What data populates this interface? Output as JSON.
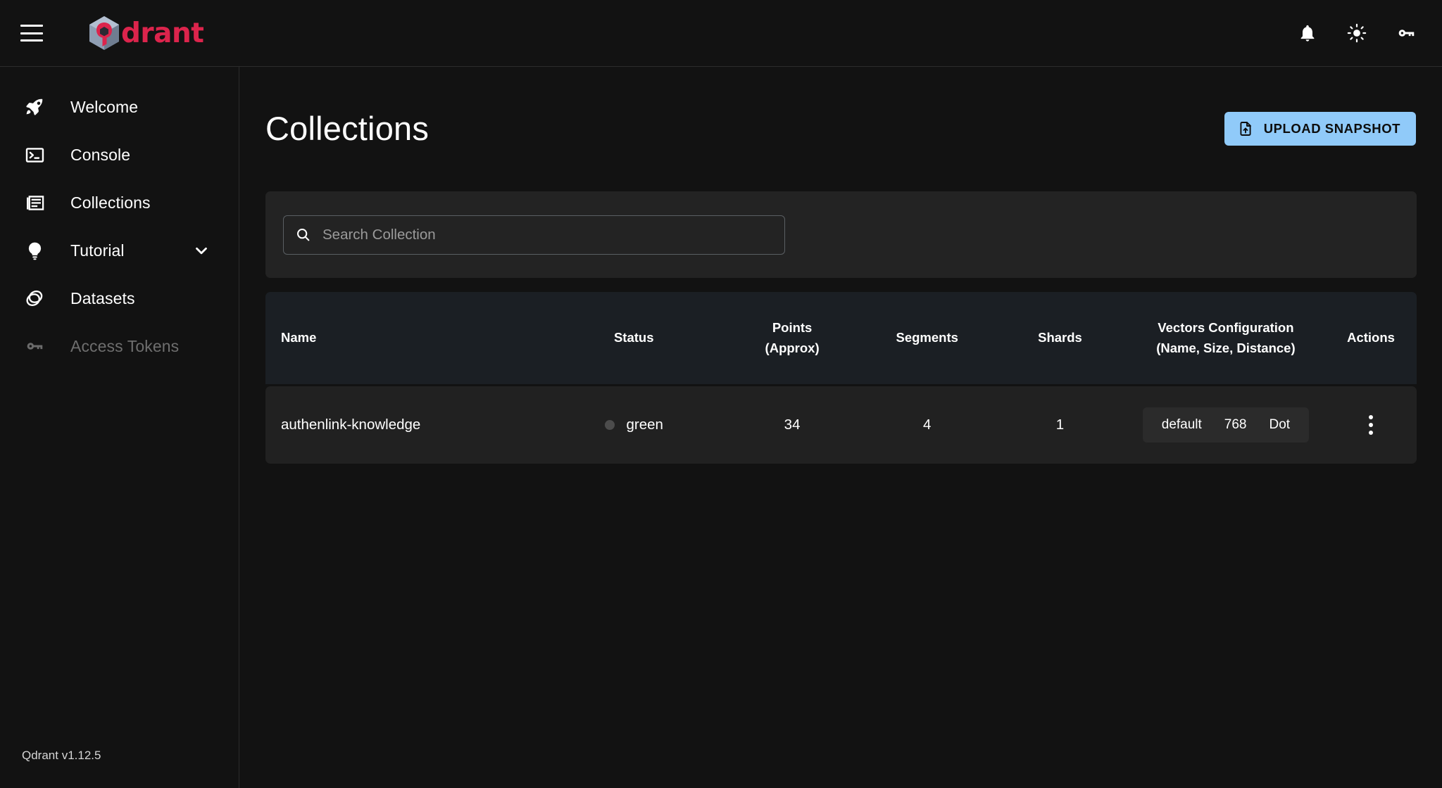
{
  "topbar": {
    "menu_icon": "hamburger-menu-icon",
    "brand": {
      "logo_icon": "qdrant-logo-icon",
      "name": "drant",
      "accent_color": "#dc244c"
    },
    "actions": [
      {
        "name": "notifications-icon",
        "label": "Notifications"
      },
      {
        "name": "theme-toggle-icon",
        "label": "Toggle theme"
      },
      {
        "name": "api-key-icon",
        "label": "API key"
      }
    ]
  },
  "sidebar": {
    "items": [
      {
        "label": "Welcome",
        "icon": "rocket-icon",
        "disabled": false,
        "expandable": false
      },
      {
        "label": "Console",
        "icon": "terminal-icon",
        "disabled": false,
        "expandable": false
      },
      {
        "label": "Collections",
        "icon": "collections-icon",
        "disabled": false,
        "expandable": false
      },
      {
        "label": "Tutorial",
        "icon": "lightbulb-icon",
        "disabled": false,
        "expandable": true
      },
      {
        "label": "Datasets",
        "icon": "datasets-icon",
        "disabled": false,
        "expandable": false
      },
      {
        "label": "Access Tokens",
        "icon": "key-icon",
        "disabled": true,
        "expandable": false
      }
    ],
    "version": "Qdrant v1.12.5"
  },
  "main": {
    "title": "Collections",
    "upload_button": {
      "label": "UPLOAD SNAPSHOT",
      "icon": "file-upload-icon",
      "color": "#90caf9"
    },
    "search": {
      "placeholder": "Search Collection",
      "value": "",
      "icon": "search-icon"
    },
    "table": {
      "headers": {
        "name": "Name",
        "status": "Status",
        "points_line1": "Points",
        "points_line2": "(Approx)",
        "segments": "Segments",
        "shards": "Shards",
        "vectors_line1": "Vectors Configuration",
        "vectors_line2": "(Name, Size, Distance)",
        "actions": "Actions"
      },
      "rows": [
        {
          "name": "authenlink-knowledge",
          "status": "green",
          "status_dot_color": "#4c4c4c",
          "points": "34",
          "segments": "4",
          "shards": "1",
          "vectors": {
            "name": "default",
            "size": "768",
            "distance": "Dot"
          },
          "actions_icon": "more-vertical-icon"
        }
      ]
    }
  }
}
